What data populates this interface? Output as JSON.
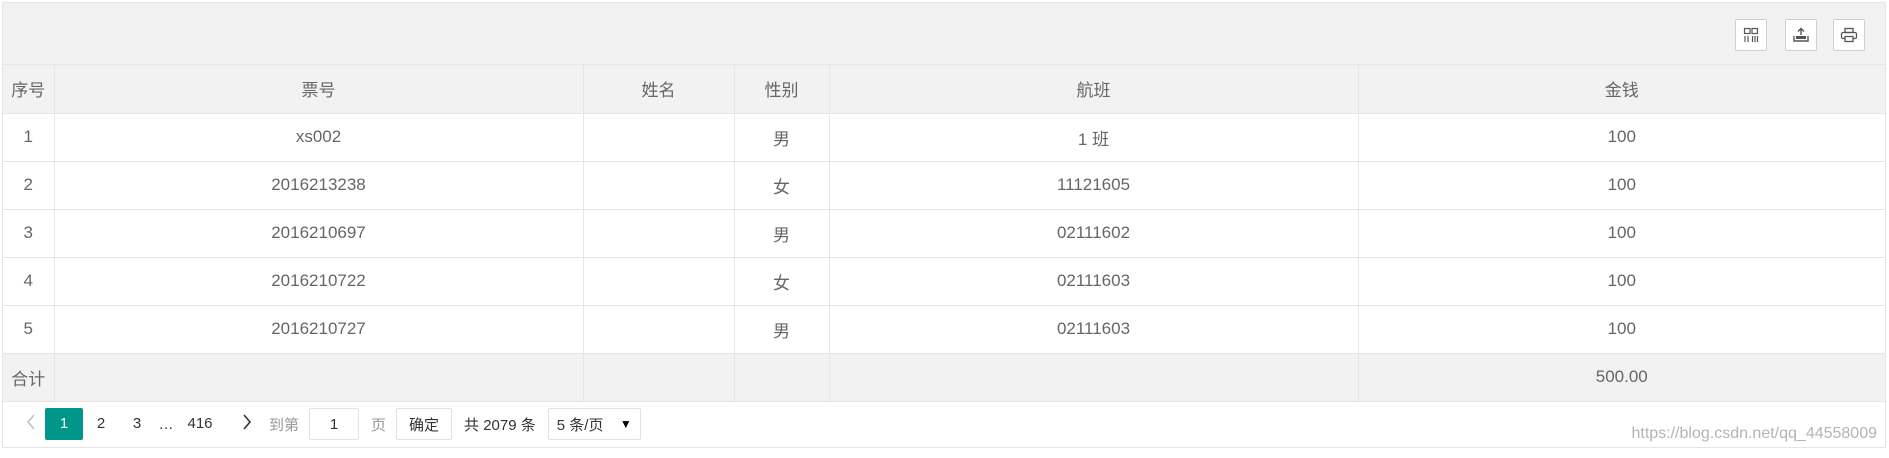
{
  "toolbar": {
    "icons": [
      "columns-filter-icon",
      "export-icon",
      "print-icon"
    ]
  },
  "table": {
    "headers": [
      "序号",
      "票号",
      "姓名",
      "性别",
      "航班",
      "金钱"
    ],
    "rows": [
      [
        "1",
        "xs002",
        "",
        "男",
        "1 班",
        "100"
      ],
      [
        "2",
        "2016213238",
        "",
        "女",
        "11121605",
        "100"
      ],
      [
        "3",
        "2016210697",
        "",
        "男",
        "02111602",
        "100"
      ],
      [
        "4",
        "2016210722",
        "",
        "女",
        "02111603",
        "100"
      ],
      [
        "5",
        "2016210727",
        "",
        "男",
        "02111603",
        "100"
      ]
    ],
    "footer": {
      "label": "合计",
      "total": "500.00"
    }
  },
  "pager": {
    "pages": [
      "1",
      "2",
      "3"
    ],
    "ellipsis": "…",
    "last_page": "416",
    "goto_label": "到第",
    "goto_value": "1",
    "page_unit": "页",
    "confirm_label": "确定",
    "total_text": "共 2079 条",
    "page_size": "5 条/页"
  },
  "watermark": "https://blog.csdn.net/qq_44558009",
  "colors": {
    "accent": "#009688",
    "header_bg": "#f2f2f2",
    "border": "#e6e6e6"
  }
}
